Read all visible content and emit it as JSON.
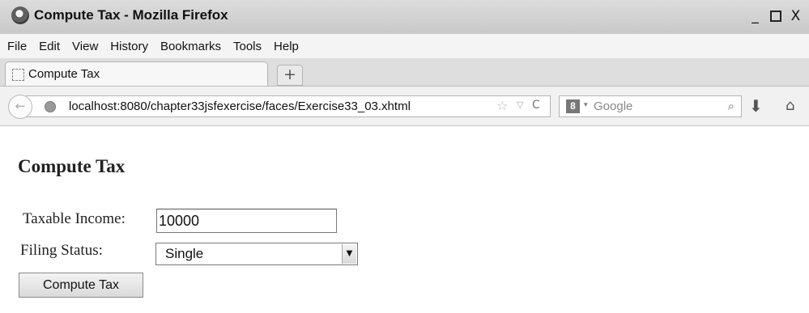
{
  "window": {
    "title": "Compute Tax - Mozilla Firefox",
    "minimize_glyph": "_",
    "close_glyph": "X"
  },
  "menubar": {
    "items": [
      "File",
      "Edit",
      "View",
      "History",
      "Bookmarks",
      "Tools",
      "Help"
    ]
  },
  "tabs": [
    {
      "label": "Compute Tax",
      "active": true
    }
  ],
  "newtab_glyph": "+",
  "navbar": {
    "back_glyph": "←",
    "url": "localhost:8080/chapter33jsfexercise/faces/Exercise33_03.xhtml",
    "star_glyph": "☆",
    "dropmarker_glyph": "▽",
    "reload_glyph": "C",
    "search_engine_glyph": "8",
    "search_engine_arrow": "▾",
    "search_placeholder": "Google",
    "search_glyph": "⌕",
    "download_glyph": "⬇",
    "home_glyph": "⌂"
  },
  "page": {
    "heading": "Compute Tax",
    "income_label": "Taxable Income:",
    "income_value": "10000",
    "status_label": "Filing Status:",
    "status_value": "Single",
    "status_dropdown_glyph": "▼",
    "button_label": "Compute Tax"
  },
  "colors": {
    "titlebar": "#d2d2d2",
    "menubar": "#f4f4f4",
    "tabstrip": "#dedede",
    "navbar": "#f1f1f1",
    "page_background": "#ffffff"
  }
}
